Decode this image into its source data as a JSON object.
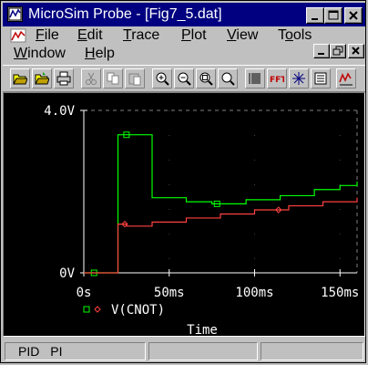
{
  "window": {
    "title": "MicroSim Probe - [Fig7_5.dat]",
    "colors": {
      "titlebar": "#000080",
      "face": "#c0c0c0",
      "plot_bg": "#000000",
      "axis": "#ffffff",
      "grid": "#808080"
    }
  },
  "menu": {
    "items": [
      {
        "label": "File",
        "hotkey": "F"
      },
      {
        "label": "Edit",
        "hotkey": "E"
      },
      {
        "label": "Trace",
        "hotkey": "T"
      },
      {
        "label": "Plot",
        "hotkey": "P"
      },
      {
        "label": "View",
        "hotkey": "V"
      },
      {
        "label": "Tools",
        "hotkey": "o"
      },
      {
        "label": "Window",
        "hotkey": "W"
      },
      {
        "label": "Help",
        "hotkey": "H"
      }
    ]
  },
  "toolbar": {
    "icons": [
      "open-icon",
      "open-file-icon",
      "print-icon",
      "cut-icon",
      "copy-icon",
      "paste-icon",
      "zoom-in-icon",
      "zoom-out-icon",
      "zoom-area-icon",
      "zoom-fit-icon",
      "log-x-icon",
      "fft-icon",
      "performance-icon",
      "add-trace-icon",
      "mark-label-icon"
    ]
  },
  "chart_data": {
    "type": "line",
    "xlabel": "Time",
    "ylabel": "",
    "xlim": [
      0,
      160
    ],
    "ylim": [
      0,
      4
    ],
    "x_ticks": [
      {
        "value": 0,
        "label": "0s"
      },
      {
        "value": 50,
        "label": "50ms"
      },
      {
        "value": 100,
        "label": "100ms"
      },
      {
        "value": 150,
        "label": "150ms"
      }
    ],
    "y_ticks": [
      {
        "value": 0,
        "label": "0V"
      },
      {
        "value": 4,
        "label": "4.0V"
      }
    ],
    "grid": true,
    "legend_placement": "bottom-left",
    "series": [
      {
        "name": "",
        "color": "#00ff00",
        "marker": "square",
        "step": true,
        "x": [
          0,
          20,
          20,
          40,
          40,
          60,
          75,
          95,
          115,
          135,
          150,
          160
        ],
        "y": [
          0,
          0,
          3.4,
          3.4,
          1.85,
          1.75,
          1.7,
          1.8,
          1.9,
          2.05,
          2.15,
          2.25
        ],
        "marker_x": [
          6,
          25,
          78
        ]
      },
      {
        "name": "V(CNOT)",
        "color": "#ff4040",
        "marker": "diamond",
        "step": true,
        "x": [
          0,
          20,
          20,
          25,
          40,
          60,
          80,
          100,
          120,
          140,
          160
        ],
        "y": [
          0,
          0,
          1.2,
          1.15,
          1.25,
          1.35,
          1.45,
          1.55,
          1.65,
          1.75,
          1.85
        ],
        "marker_x": [
          24,
          114
        ]
      }
    ]
  },
  "statusbar": {
    "left": "PID",
    "right": "PI"
  }
}
